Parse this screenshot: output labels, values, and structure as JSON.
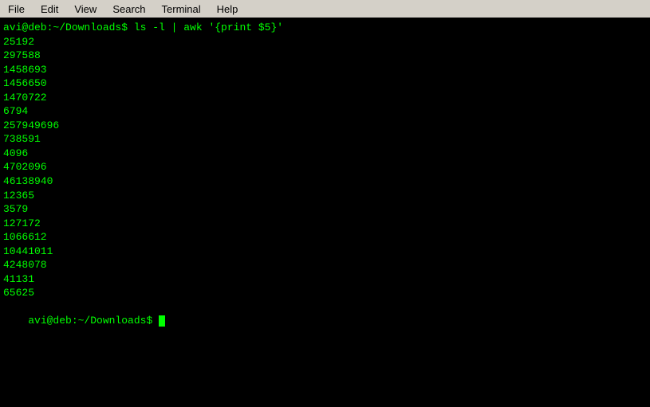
{
  "menubar": {
    "items": [
      {
        "label": "File",
        "id": "file"
      },
      {
        "label": "Edit",
        "id": "edit"
      },
      {
        "label": "View",
        "id": "view"
      },
      {
        "label": "Search",
        "id": "search"
      },
      {
        "label": "Terminal",
        "id": "terminal"
      },
      {
        "label": "Help",
        "id": "help"
      }
    ]
  },
  "terminal": {
    "prompt1": "avi@deb:~/Downloads$ ls -l | awk '{print $5}'",
    "output_lines": [
      "25192",
      "297588",
      "1458693",
      "1456650",
      "1470722",
      "6794",
      "257949696",
      "738591",
      "4096",
      "4702096",
      "46138940",
      "12365",
      "3579",
      "127172",
      "1066612",
      "10441011",
      "4248078",
      "41131",
      "65625"
    ],
    "prompt2": "avi@deb:~/Downloads$ "
  }
}
